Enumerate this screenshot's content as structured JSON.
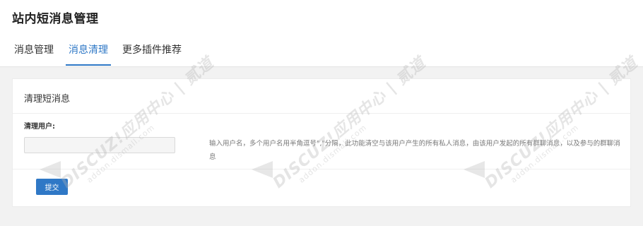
{
  "header": {
    "title": "站内短消息管理"
  },
  "tabs": [
    {
      "label": "消息管理",
      "active": false
    },
    {
      "label": "消息清理",
      "active": true
    },
    {
      "label": "更多插件推荐",
      "active": false
    }
  ],
  "card": {
    "title": "清理短消息",
    "field_label": "清理用户:",
    "input_value": "",
    "input_placeholder": "",
    "help_text": "输入用户名，多个用户名用半角逗号\",\"分隔，此功能清空与该用户产生的所有私人消息，由该用户发起的所有群聊消息，以及参与的群聊消息",
    "submit_label": "提交"
  },
  "watermark": {
    "brand": "DISCUZ!应用中心 | 贰道",
    "sub": "addon.dismall.com"
  },
  "colors": {
    "accent": "#2f78c6",
    "background": "#f2f2f2",
    "card": "#ffffff"
  }
}
